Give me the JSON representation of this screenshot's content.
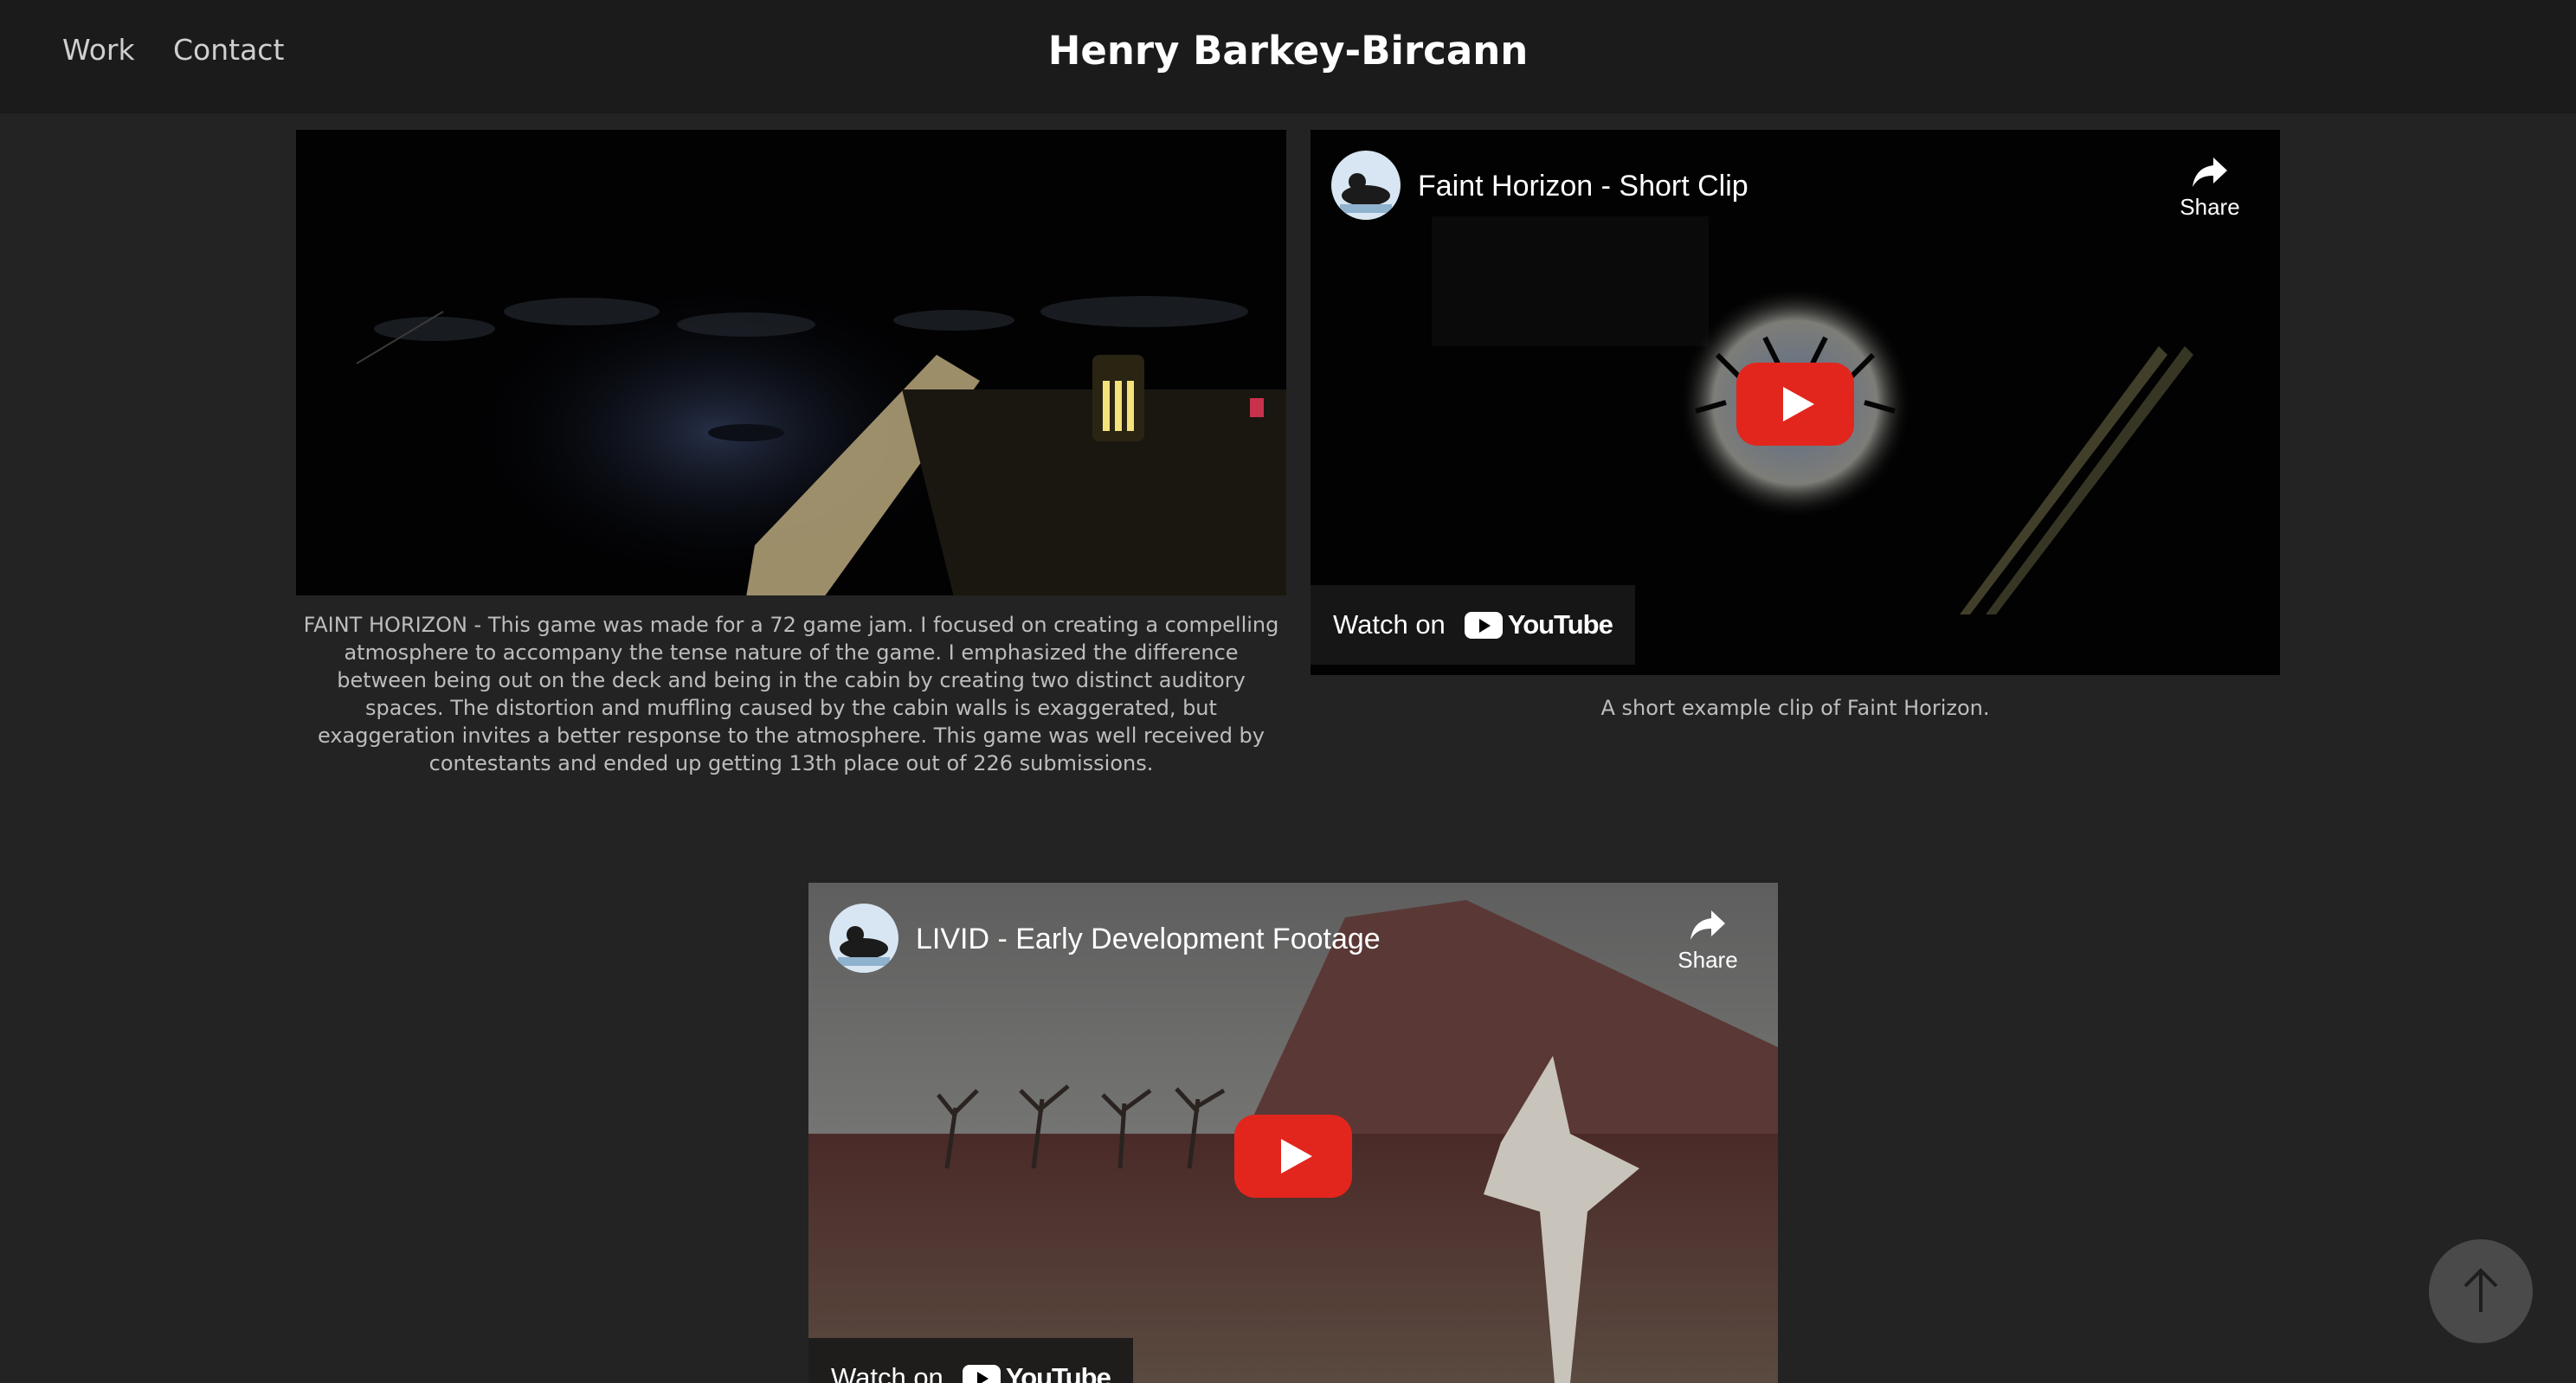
{
  "header": {
    "nav": [
      "Work",
      "Contact"
    ],
    "site_title": "Henry Barkey-Bircann"
  },
  "faint_horizon": {
    "caption": "FAINT HORIZON - This game was made for a 72 game jam. I focused on creating a compelling atmosphere to accompany the tense nature of the game. I emphasized the difference between being out on the deck and being in the cabin by creating two distinct auditory spaces. The distortion and muffling caused by the cabin walls is exaggerated, but exaggeration invites a better response to the atmosphere. This game was well received by contestants and ended up getting 13th place out of 226 submissions.",
    "video": {
      "title": "Faint Horizon - Short Clip",
      "share_label": "Share",
      "watch_on_label": "Watch on",
      "youtube_label": "YouTube",
      "caption": "A short example clip of Faint Horizon."
    }
  },
  "livid": {
    "video": {
      "title": "LIVID - Early Development Footage",
      "share_label": "Share",
      "watch_on_label": "Watch on",
      "youtube_label": "YouTube"
    }
  },
  "colors": {
    "background": "#232323",
    "header": "#1b1b1b",
    "play_button": "#e2261d"
  }
}
